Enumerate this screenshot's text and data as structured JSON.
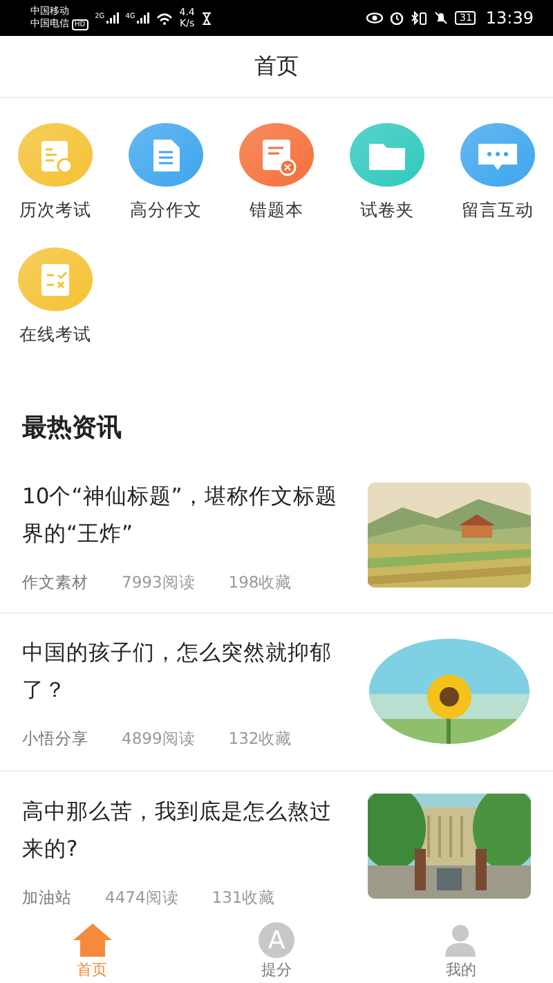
{
  "status_bar": {
    "carrier_1": "中国移动",
    "carrier_2": "中国电信",
    "hd": "HD",
    "signal_1": "2G",
    "signal_2": "4G",
    "speed_value": "4.4",
    "speed_unit": "K/s",
    "battery": "31",
    "time": "13:39"
  },
  "header": {
    "title": "首页"
  },
  "shortcuts": [
    {
      "label": "历次考试",
      "kind": "exam",
      "color": "#f5c234"
    },
    {
      "label": "高分作文",
      "kind": "doc",
      "color": "#3ea6ee"
    },
    {
      "label": "错题本",
      "kind": "wrong",
      "color": "#f5703a"
    },
    {
      "label": "试卷夹",
      "kind": "folder",
      "color": "#2fc9bd"
    },
    {
      "label": "留言互动",
      "kind": "chat",
      "color": "#3ea6ee"
    },
    {
      "label": "在线考试",
      "kind": "clipboard",
      "color": "#f5c234"
    }
  ],
  "news": {
    "title": "最热资讯",
    "articles": [
      {
        "title": "10个“神仙标题”，堪称作文标题界的“王炸”",
        "source": "作文素材",
        "reads": "7993阅读",
        "favorites": "198收藏"
      },
      {
        "title": "中国的孩子们，怎么突然就抑郁了？",
        "source": "小悟分享",
        "reads": "4899阅读",
        "favorites": "132收藏"
      },
      {
        "title": "高中那么苦，我到底是怎么熬过来的?",
        "source": "加油站",
        "reads": "4474阅读",
        "favorites": "131收藏"
      }
    ]
  },
  "tab_bar": [
    {
      "label": "首页",
      "kind": "home",
      "selected": true
    },
    {
      "label": "提分",
      "kind": "letter",
      "icon_text": "A",
      "selected": false
    },
    {
      "label": "我的",
      "kind": "person",
      "selected": false
    }
  ]
}
